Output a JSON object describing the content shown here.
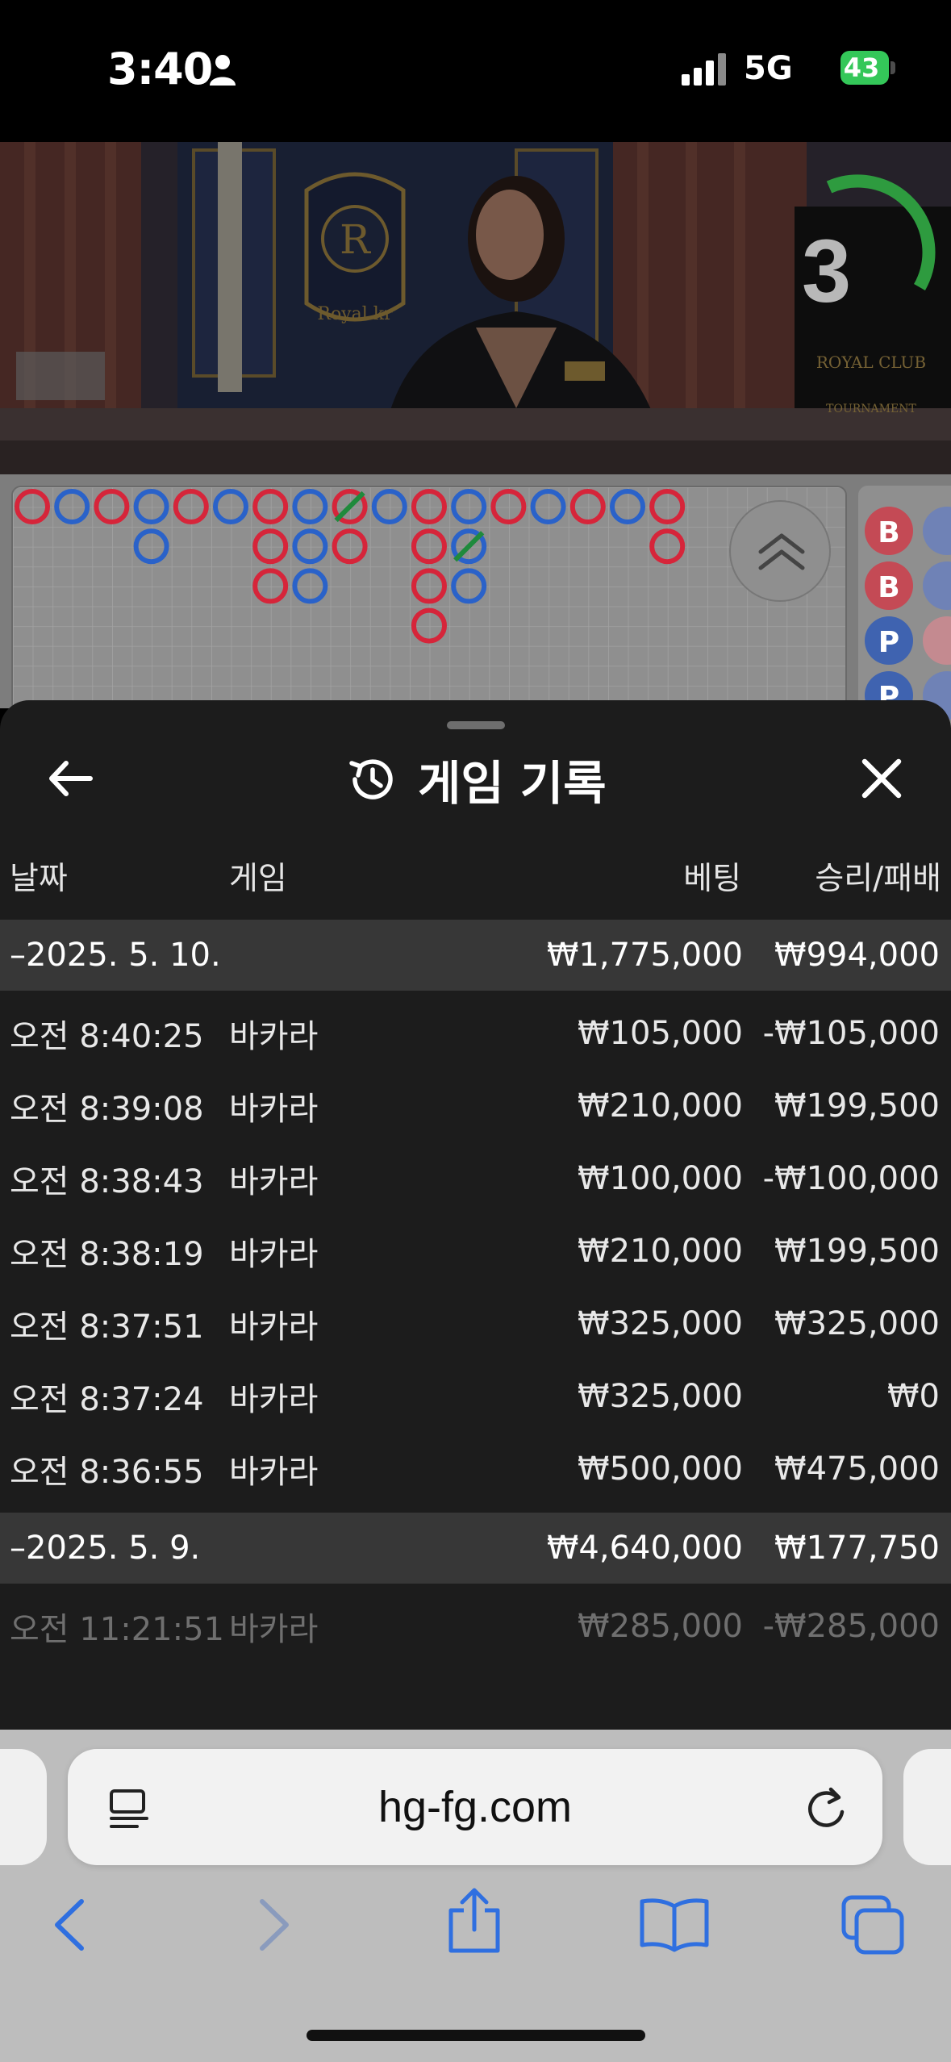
{
  "status_bar": {
    "time": "3:40",
    "network": "5G",
    "battery": "43",
    "icons": [
      "person-icon",
      "signal-icon",
      "battery-charging-icon"
    ]
  },
  "video": {
    "countdown": "3",
    "countdown_color": "#2e9b3f"
  },
  "roadmap": {
    "colors": {
      "banker": "#d6253a",
      "player": "#2a62c9",
      "tie": "#1f8a3c"
    },
    "side_labels": [
      "B",
      "B",
      "P",
      "P"
    ]
  },
  "sheet": {
    "title": "게임 기록",
    "columns": {
      "date": "날짜",
      "game": "게임",
      "bet": "베팅",
      "win_loss": "승리/패배"
    },
    "rows": [
      {
        "type": "group",
        "date": "–2025. 5. 10.",
        "game": "",
        "bet": "₩1,775,000",
        "win_loss": "₩994,000"
      },
      {
        "type": "item",
        "date": "오전 8:40:25",
        "game": "바카라",
        "bet": "₩105,000",
        "win_loss": "-₩105,000"
      },
      {
        "type": "item",
        "date": "오전 8:39:08",
        "game": "바카라",
        "bet": "₩210,000",
        "win_loss": "₩199,500"
      },
      {
        "type": "item",
        "date": "오전 8:38:43",
        "game": "바카라",
        "bet": "₩100,000",
        "win_loss": "-₩100,000"
      },
      {
        "type": "item",
        "date": "오전 8:38:19",
        "game": "바카라",
        "bet": "₩210,000",
        "win_loss": "₩199,500"
      },
      {
        "type": "item",
        "date": "오전 8:37:51",
        "game": "바카라",
        "bet": "₩325,000",
        "win_loss": "₩325,000"
      },
      {
        "type": "item",
        "date": "오전 8:37:24",
        "game": "바카라",
        "bet": "₩325,000",
        "win_loss": "₩0"
      },
      {
        "type": "item",
        "date": "오전 8:36:55",
        "game": "바카라",
        "bet": "₩500,000",
        "win_loss": "₩475,000"
      },
      {
        "type": "group",
        "date": "–2025. 5. 9.",
        "game": "",
        "bet": "₩4,640,000",
        "win_loss": "₩177,750"
      },
      {
        "type": "item dim",
        "date": "오전 11:21:51",
        "game": "바카라",
        "bet": "₩285,000",
        "win_loss": "-₩285,000"
      }
    ]
  },
  "browser": {
    "url": "hg-fg.com",
    "accent": "#2f6fe0"
  }
}
